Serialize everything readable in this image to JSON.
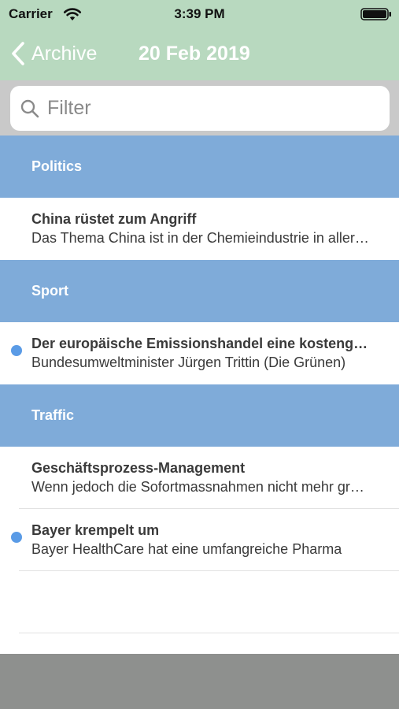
{
  "status_bar": {
    "carrier": "Carrier",
    "time": "3:39 PM"
  },
  "nav": {
    "back_label": "Archive",
    "title": "20 Feb 2019"
  },
  "search": {
    "placeholder": "Filter"
  },
  "sections": [
    {
      "title": "Politics",
      "items": [
        {
          "title": "China rüstet zum Angriff",
          "subtitle": "Das Thema China ist in der Chemieindustrie in aller Munde",
          "unread": false
        }
      ]
    },
    {
      "title": "Sport",
      "items": [
        {
          "title": "Der europäische Emissionshandel  eine kostengünstige Lösung",
          "subtitle": "Bundesumweltminister Jürgen Trittin (Die Grünen)",
          "unread": true
        }
      ]
    },
    {
      "title": "Traffic",
      "items": [
        {
          "title": "Geschäftsprozess-Management",
          "subtitle": "Wenn jedoch die Sofortmassnahmen nicht mehr greifen",
          "unread": false
        },
        {
          "title": "Bayer krempelt um",
          "subtitle": "Bayer HealthCare hat eine umfangreiche Pharma",
          "unread": true
        }
      ]
    }
  ],
  "colors": {
    "header": "#b8d9bf",
    "section_header": "#7fabd9",
    "unread_dot": "#5a9be6",
    "footer": "#8e908e"
  }
}
